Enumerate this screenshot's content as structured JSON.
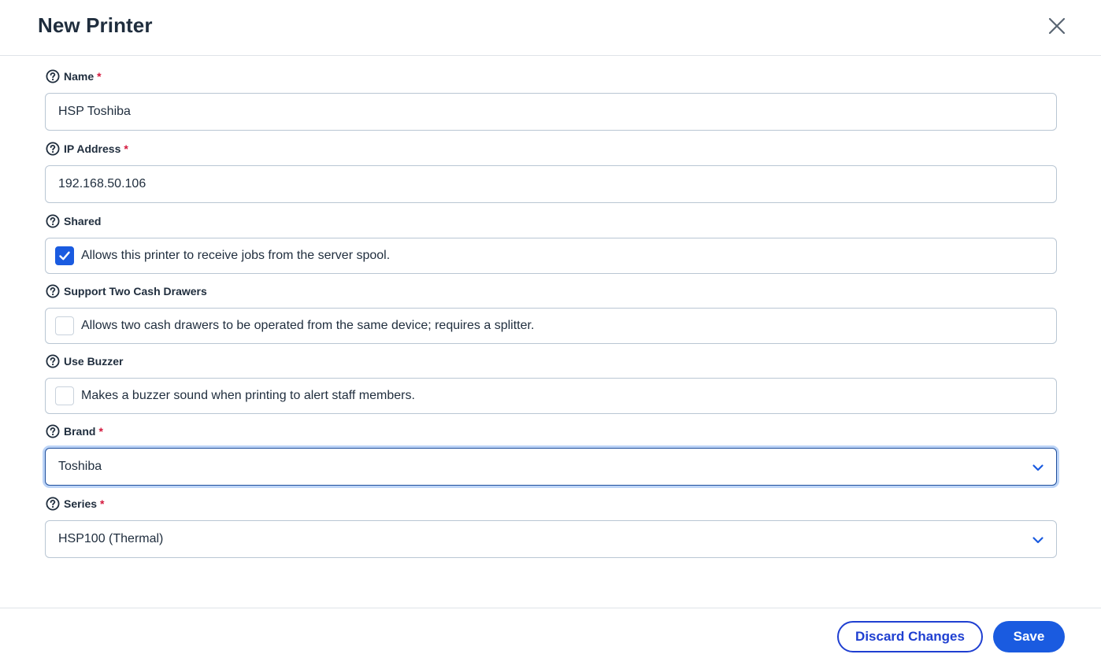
{
  "dialog": {
    "title": "New Printer"
  },
  "fields": {
    "name": {
      "label": "Name",
      "required": "*",
      "value": "HSP Toshiba"
    },
    "ip": {
      "label": "IP Address",
      "required": "*",
      "value": "192.168.50.106"
    },
    "shared": {
      "label": "Shared",
      "description": "Allows this printer to receive jobs from the server spool.",
      "checked": true
    },
    "two_drawers": {
      "label": "Support Two Cash Drawers",
      "description": "Allows two cash drawers to be operated from the same device; requires a splitter.",
      "checked": false
    },
    "buzzer": {
      "label": "Use Buzzer",
      "description": "Makes a buzzer sound when printing to alert staff members.",
      "checked": false
    },
    "brand": {
      "label": "Brand",
      "required": "*",
      "value": "Toshiba"
    },
    "series": {
      "label": "Series",
      "required": "*",
      "value": "HSP100 (Thermal)"
    }
  },
  "footer": {
    "discard_label": "Discard Changes",
    "save_label": "Save"
  },
  "colors": {
    "primary": "#1a5be0",
    "discard_border": "#1f3fd1",
    "required": "#d4183d",
    "text": "#1f2d3d",
    "input_border": "#b9c6d3"
  },
  "icons": {
    "help": "question-circle-icon",
    "close": "close-icon",
    "chevron": "chevron-down-icon",
    "check": "checkmark-icon"
  }
}
